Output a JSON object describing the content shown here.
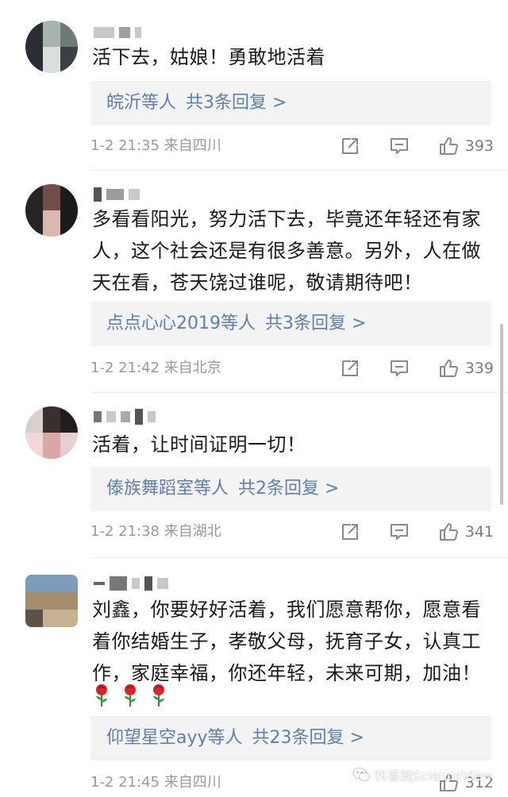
{
  "comments": [
    {
      "text": "活下去，姑娘！勇敢地活着",
      "reply_who": "皖沂等人",
      "reply_more": "共3条回复 >",
      "meta": "1-2 21:35 来自四川",
      "likes": "393"
    },
    {
      "text": "多看看阳光，努力活下去，毕竟还年轻还有家人，这个社会还是有很多善意。另外，人在做天在看，苍天饶过谁呢，敬请期待吧！",
      "reply_who": "点点心心2019等人",
      "reply_more": "共3条回复 >",
      "meta": "1-2 21:42 来自北京",
      "likes": "339"
    },
    {
      "text": "活着，让时间证明一切！",
      "reply_who": "傣族舞蹈室等人",
      "reply_more": "共2条回复 >",
      "meta": "1-2 21:38 来自湖北",
      "likes": "341"
    },
    {
      "text": "刘鑫，你要好好活着，我们愿意帮你，愿意看着你结婚生子，孝敬父母，抚育子女，认真工作，家庭幸福，你还年轻，未来可期，加油！",
      "reply_who": "仰望星空ayy等人",
      "reply_more": "共23条回复 >",
      "meta": "1-2 21:45 来自四川",
      "likes": "312"
    }
  ],
  "watermark": "科普观ScienceView",
  "colors": {
    "link": "#5e7fad",
    "meta": "#9a9a9a",
    "reply_bg": "#f3f3f3"
  },
  "icons": [
    "repost-icon",
    "comment-icon",
    "like-icon",
    "rose-emoji",
    "wechat-icon"
  ]
}
